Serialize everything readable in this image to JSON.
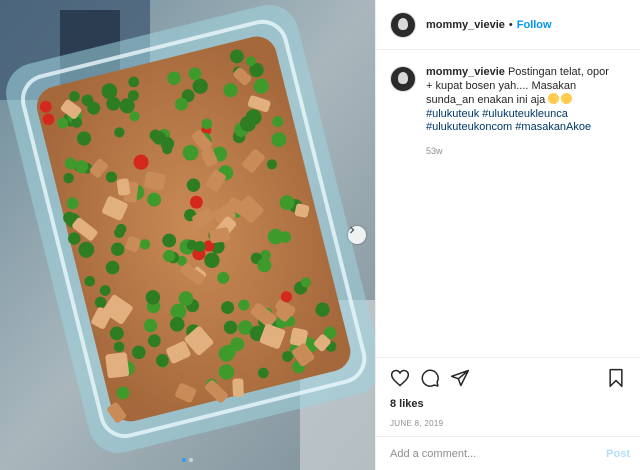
{
  "header": {
    "username": "mommy_vievie",
    "separator": "•",
    "follow_label": "Follow"
  },
  "caption": {
    "username": "mommy_vievie",
    "text": "Postingan telat, opor + kupat bosen yah.... Masakan sunda_an enakan ini aja",
    "emojis": [
      "smiling-face-emoji",
      "smiling-face-emoji"
    ],
    "hashtags": [
      "#ulukuteuk",
      "#ulukuteukleunca",
      "#ulukuteukoncom",
      "#masakanAkoe"
    ],
    "time": "53w"
  },
  "actions": {
    "like_icon": "heart-icon",
    "comment_icon": "comment-icon",
    "share_icon": "share-icon",
    "save_icon": "bookmark-icon"
  },
  "likes": "8 likes",
  "date": "JUNE 8, 2019",
  "comment_box": {
    "placeholder": "Add a comment...",
    "post_label": "Post"
  },
  "carousel": {
    "slide_count": 2,
    "active_index": 0
  },
  "colors": {
    "accent": "#0095f6",
    "post_disabled": "#b2dffc",
    "hashtag": "#00376b",
    "muted": "#8e8e8e"
  }
}
